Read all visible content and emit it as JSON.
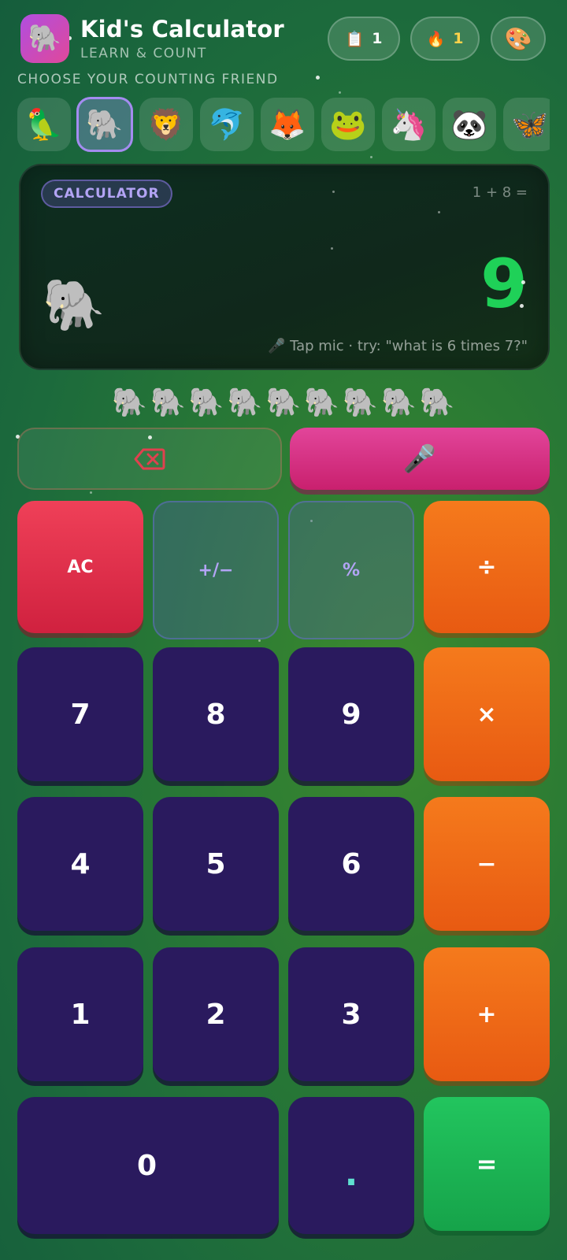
{
  "header": {
    "app_icon": "🐘",
    "title": "Kid's Calculator",
    "subtitle": "LEARN & COUNT",
    "history": {
      "icon": "📋",
      "count": "1"
    },
    "streak": {
      "icon": "🔥",
      "count": "1"
    },
    "theme_icon": "🎨"
  },
  "friends_label": "CHOOSE YOUR COUNTING FRIEND",
  "friends": [
    "🦜",
    "🐘",
    "🦁",
    "🐬",
    "🦊",
    "🐸",
    "🦄",
    "🐼",
    "🦋"
  ],
  "selected_friend_index": 1,
  "display": {
    "mode": "CALCULATOR",
    "expression": "1 + 8 =",
    "friend": "🐘",
    "result": "9",
    "hint": "🎤 Tap mic · try: \"what is 6 times 7?\""
  },
  "count_row": [
    "🐘",
    "🐘",
    "🐘",
    "🐘",
    "🐘",
    "🐘",
    "🐘",
    "🐘",
    "🐘"
  ],
  "actions": {
    "backspace_icon": "backspace-icon",
    "mic": "🎤"
  },
  "keys": {
    "ac": "AC",
    "sign": "+/−",
    "percent": "%",
    "divide": "÷",
    "seven": "7",
    "eight": "8",
    "nine": "9",
    "multiply": "×",
    "four": "4",
    "five": "5",
    "six": "6",
    "minus": "−",
    "one": "1",
    "two": "2",
    "three": "3",
    "plus": "+",
    "zero": "0",
    "decimal": ".",
    "equals": "="
  },
  "colors": {
    "accent_purple": "#a48cf0",
    "result_green": "#1fd158",
    "operator_orange": "#f57a1c",
    "number_key": "#2a1a5e",
    "ac_red": "#ef4058",
    "mic_pink": "#e2459a",
    "equals_green": "#22c55e"
  }
}
